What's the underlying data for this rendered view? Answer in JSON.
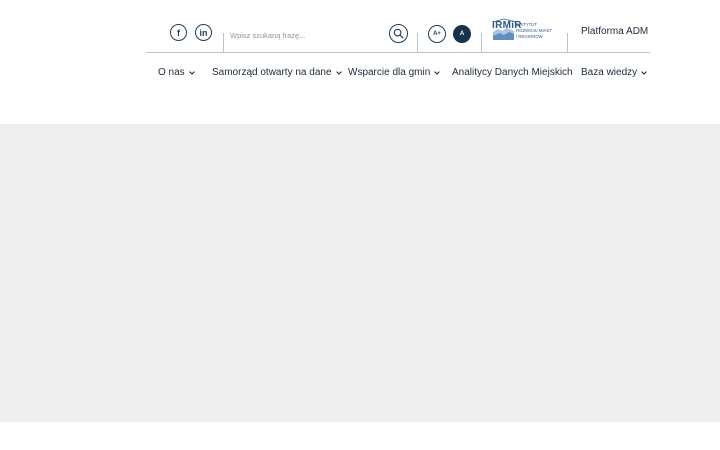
{
  "social": {
    "facebook_glyph": "f",
    "linkedin_glyph": "in"
  },
  "search": {
    "placeholder": "Wpisz szukaną frazę..."
  },
  "accessibility": {
    "font_increase_label": "A+",
    "font_default_label": "A"
  },
  "logo": {
    "wordmark": "IRMiR",
    "line1": "INSTYTUT",
    "line2": "ROZWOJU MIAST",
    "line3": "I REGIONÓW"
  },
  "header": {
    "platform_link": "Platforma ADM"
  },
  "nav": {
    "items": [
      {
        "label": "O nas"
      },
      {
        "label": "Samorząd otwarty na dane"
      },
      {
        "label": "Wsparcie dla gmin"
      },
      {
        "label": "Analitycy Danych Miejskich"
      },
      {
        "label": "Baza wiedzy"
      }
    ]
  },
  "colors": {
    "primary": "#17324d",
    "border": "#b9c2cc",
    "band": "#efefef",
    "logo_blue": "#2a5a86"
  }
}
